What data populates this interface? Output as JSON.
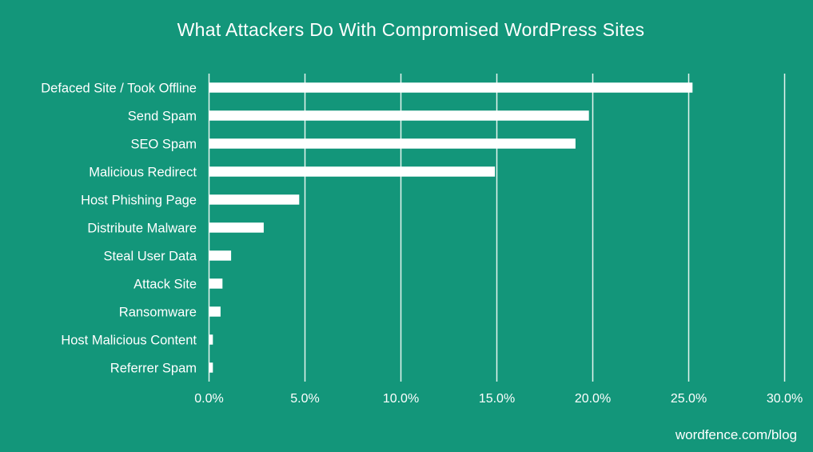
{
  "chart_data": {
    "type": "bar",
    "orientation": "horizontal",
    "title": "What Attackers Do With Compromised WordPress Sites",
    "xlabel": "",
    "ylabel": "",
    "categories": [
      "Defaced Site / Took Offline",
      "Send Spam",
      "SEO Spam",
      "Malicious Redirect",
      "Host Phishing Page",
      "Distribute Malware",
      "Steal User Data",
      "Attack Site",
      "Ransomware",
      "Host Malicious Content",
      "Referrer Spam"
    ],
    "values": [
      25.2,
      19.8,
      19.1,
      14.9,
      4.7,
      2.85,
      1.15,
      0.7,
      0.6,
      0.2,
      0.2
    ],
    "value_unit": "percent",
    "xlim": [
      0,
      30
    ],
    "x_ticks": [
      0,
      5,
      10,
      15,
      20,
      25,
      30
    ],
    "x_tick_labels": [
      "0.0%",
      "5.0%",
      "10.0%",
      "15.0%",
      "20.0%",
      "25.0%",
      "30.0%"
    ],
    "grid": "vertical",
    "legend": "none",
    "colors": {
      "background": "#13967a",
      "bars": "#ffffff",
      "text": "#ffffff",
      "grid": "#e6f5ef"
    }
  },
  "footer": {
    "source": "wordfence.com/blog"
  }
}
